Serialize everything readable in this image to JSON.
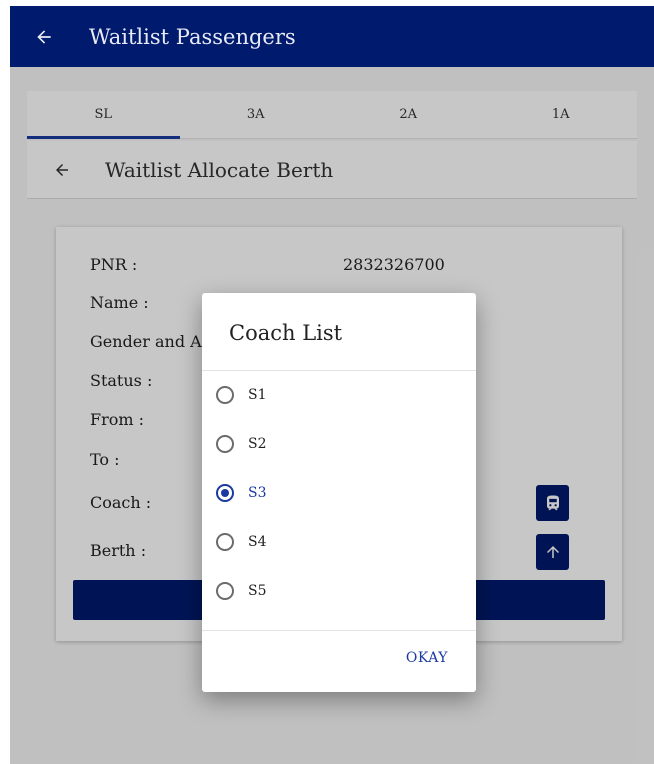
{
  "appbar": {
    "title": "Waitlist Passengers"
  },
  "tabs": [
    {
      "label": "SL",
      "active": true
    },
    {
      "label": "3A",
      "active": false
    },
    {
      "label": "2A",
      "active": false
    },
    {
      "label": "1A",
      "active": false
    }
  ],
  "subbar": {
    "title": "Waitlist Allocate Berth"
  },
  "card": {
    "pnr_label": "PNR :",
    "pnr_value": "2832326700",
    "name_label": "Name :",
    "gender_label": "Gender and A",
    "status_label": "Status :",
    "from_label": "From :",
    "to_label": "To :",
    "coach_label": "Coach :",
    "berth_label": "Berth :"
  },
  "dialog": {
    "title": "Coach List",
    "options": [
      {
        "label": "S1",
        "checked": false
      },
      {
        "label": "S2",
        "checked": false
      },
      {
        "label": "S3",
        "checked": true
      },
      {
        "label": "S4",
        "checked": false
      },
      {
        "label": "S5",
        "checked": false
      }
    ],
    "okay_label": "OKAY"
  },
  "colors": {
    "primary": "#001a6e",
    "accent": "#1a3aa0"
  },
  "icons": {
    "back": "arrow-left-icon",
    "coach": "train-icon",
    "upload": "arrow-up-icon"
  }
}
